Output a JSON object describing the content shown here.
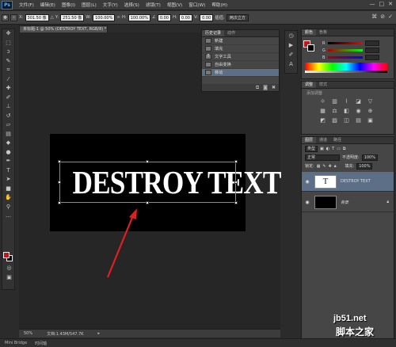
{
  "app": {
    "logo": "Ps"
  },
  "menu": [
    "文件(F)",
    "编辑(E)",
    "图像(I)",
    "图层(L)",
    "文字(Y)",
    "选择(S)",
    "滤镜(T)",
    "视图(V)",
    "窗口(W)",
    "帮助(H)"
  ],
  "window_controls": [
    "—",
    "□",
    "✕"
  ],
  "options": {
    "x_label": "X:",
    "x_value": "301.50 像",
    "y_label": "Y:",
    "y_value": "251.50 像",
    "w_label": "W:",
    "w_value": "100.00%",
    "h_label": "H:",
    "h_value": "100.00%",
    "angle_value": "0.00",
    "h2_label": "H:",
    "h2_value": "0.00",
    "v_label": "V:",
    "v_value": "0.00",
    "interp_label": "插值:",
    "interp_value": "两次立方"
  },
  "document": {
    "tab_title": "未标题-1 @ 50% (DESTROY TEXT, RGB/8) *",
    "text": "DESTROY TEXT",
    "bg_color": "#000000",
    "text_color": "#ffffff"
  },
  "status": {
    "zoom": "50%",
    "doc_info": "文档:1.43M/547.7K"
  },
  "bottom": {
    "mini_bridge": "Mini Bridge",
    "timeline": "时间轴"
  },
  "history": {
    "tabs": [
      "历史记录",
      "动作"
    ],
    "items": [
      {
        "label": "新建",
        "icon": "document-icon"
      },
      {
        "label": "填充",
        "icon": "fill-icon"
      },
      {
        "label": "文字工具",
        "icon": "type-icon",
        "glyph": "T"
      },
      {
        "label": "自由变换",
        "icon": "transform-icon"
      },
      {
        "label": "移动",
        "icon": "move-icon",
        "active": true
      }
    ]
  },
  "color_panel": {
    "tabs": [
      "颜色",
      "色板"
    ],
    "fg": "#c0161c",
    "slider_labels": [
      "R",
      "G",
      "B"
    ]
  },
  "adjust_panel": {
    "tabs": [
      "调整",
      "样式"
    ],
    "subtitle": "添加调整"
  },
  "layers": {
    "tabs": [
      "图层",
      "通道",
      "路径"
    ],
    "kind_label": "类型",
    "blend_mode": "正常",
    "opacity_label": "不透明度:",
    "opacity_value": "100%",
    "lock_label": "锁定:",
    "fill_label": "填充:",
    "fill_value": "100%",
    "items": [
      {
        "name": "DESTROY TEXT",
        "type": "text",
        "selected": true
      },
      {
        "name": "背景",
        "type": "background",
        "selected": false
      }
    ]
  },
  "watermark": {
    "domain": "jb51.net",
    "name": "脚本之家"
  },
  "colors": {
    "accent": "#5d6f86",
    "arrow": "#e02020",
    "fg_swatch": "#c0161c"
  }
}
